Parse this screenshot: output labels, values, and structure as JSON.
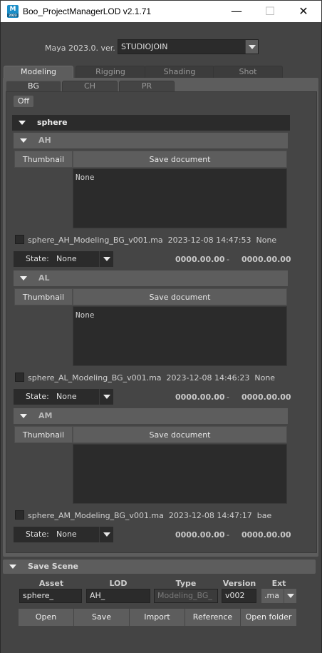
{
  "window": {
    "title": "Boo_ProjectManagerLOD v2.1.71",
    "icon_letter": "M",
    "icon_sub": "2023",
    "minimize_glyph": "—",
    "maximize_glyph": "☐",
    "close_glyph": "✕"
  },
  "version": {
    "label": "Maya 2023.0. ver. :",
    "selected": "STUDIOJOIN"
  },
  "tabs": [
    "Modeling",
    "Rigging",
    "Shading",
    "Shot"
  ],
  "subtabs": [
    "BG",
    "CH",
    "PR"
  ],
  "off_button": "Off",
  "group": {
    "label": "sphere"
  },
  "blocks": [
    {
      "label": "AH",
      "thumbnail_label": "Thumbnail",
      "save_label": "Save document",
      "document": "None",
      "filename": "sphere_AH_Modeling_BG_v001.ma",
      "timestamp": "2023-12-08 14:47:53",
      "user": "None",
      "state_label": "State:",
      "state_value": "None",
      "date_start": "0000.00.00",
      "date_sep": "-",
      "date_end": "0000.00.00"
    },
    {
      "label": "AL",
      "thumbnail_label": "Thumbnail",
      "save_label": "Save document",
      "document": "None",
      "filename": "sphere_AL_Modeling_BG_v001.ma",
      "timestamp": "2023-12-08 14:46:23",
      "user": "None",
      "state_label": "State:",
      "state_value": "None",
      "date_start": "0000.00.00",
      "date_sep": "-",
      "date_end": "0000.00.00"
    },
    {
      "label": "AM",
      "thumbnail_label": "Thumbnail",
      "save_label": "Save document",
      "document": "",
      "filename": "sphere_AM_Modeling_BG_v001.ma",
      "timestamp": "2023-12-08 14:47:17",
      "user": "bae",
      "state_label": "State:",
      "state_value": "None",
      "date_start": "0000.00.00",
      "date_sep": "-",
      "date_end": "0000.00.00"
    }
  ],
  "save_scene": {
    "label": "Save Scene",
    "columns": {
      "asset": "Asset",
      "lod": "LOD",
      "type": "Type",
      "version": "Version",
      "ext": "Ext"
    },
    "asset_value": "sphere_",
    "lod_value": "AH_",
    "type_value": "Modeling_BG_",
    "version_value": "v002",
    "ext_value": ".ma",
    "buttons": {
      "open": "Open",
      "save": "Save",
      "import": "Import",
      "reference": "Reference",
      "open_folder": "Open folder"
    }
  }
}
